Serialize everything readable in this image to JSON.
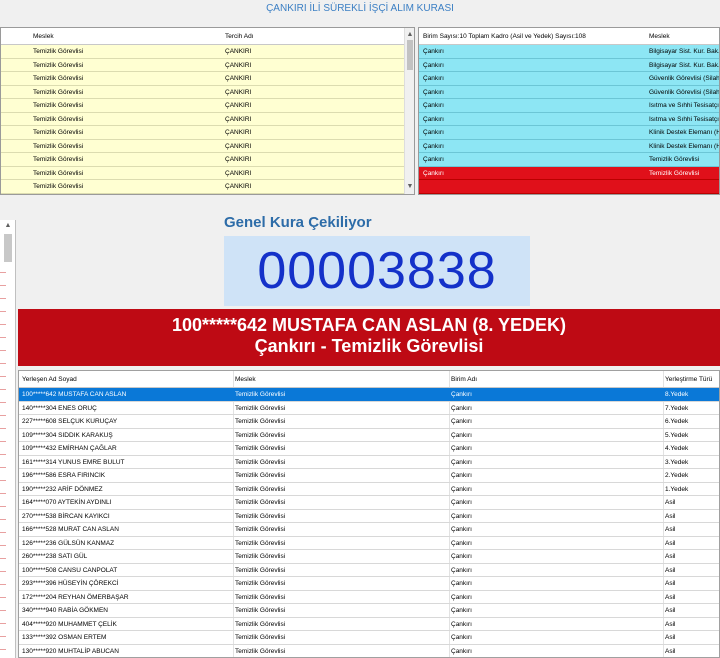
{
  "title": "ÇANKIRI İLİ SÜREKLİ İŞÇİ ALIM KURASI",
  "top_left": {
    "headers": {
      "meslek": "Meslek",
      "tercih": "Tercih Adı"
    },
    "rows": [
      {
        "meslek": "Temizlik Görevlisi",
        "tercih": "ÇANKIRI"
      },
      {
        "meslek": "Temizlik Görevlisi",
        "tercih": "ÇANKIRI"
      },
      {
        "meslek": "Temizlik Görevlisi",
        "tercih": "ÇANKIRI"
      },
      {
        "meslek": "Temizlik Görevlisi",
        "tercih": "ÇANKIRI"
      },
      {
        "meslek": "Temizlik Görevlisi",
        "tercih": "ÇANKIRI"
      },
      {
        "meslek": "Temizlik Görevlisi",
        "tercih": "ÇANKIRI"
      },
      {
        "meslek": "Temizlik Görevlisi",
        "tercih": "ÇANKIRI"
      },
      {
        "meslek": "Temizlik Görevlisi",
        "tercih": "ÇANKIRI"
      },
      {
        "meslek": "Temizlik Görevlisi",
        "tercih": "ÇANKIRI"
      },
      {
        "meslek": "Temizlik Görevlisi",
        "tercih": "ÇANKIRI"
      },
      {
        "meslek": "Temizlik Görevlisi",
        "tercih": "ÇANKIRI"
      }
    ]
  },
  "top_right": {
    "headers": {
      "birim": "Birim Sayısı:10 Toplam Kadro (Asil ve Yedek) Sayısı:108",
      "meslek": "Meslek"
    },
    "rows": [
      {
        "birim": "Çankırı",
        "meslek": "Bilgisayar Sist. Kur. Bak."
      },
      {
        "birim": "Çankırı",
        "meslek": "Bilgisayar Sist. Kur. Bak."
      },
      {
        "birim": "Çankırı",
        "meslek": "Güvenlik Görevlisi (Silahsız)"
      },
      {
        "birim": "Çankırı",
        "meslek": "Güvenlik Görevlisi (Silahsız)"
      },
      {
        "birim": "Çankırı",
        "meslek": "Isıtma ve Sıhhi Tesisatçı"
      },
      {
        "birim": "Çankırı",
        "meslek": "Isıtma ve Sıhhi Tesisatçı"
      },
      {
        "birim": "Çankırı",
        "meslek": "Klinik Destek Elemanı (H)"
      },
      {
        "birim": "Çankırı",
        "meslek": "Klinik Destek Elemanı (H)"
      },
      {
        "birim": "Çankırı",
        "meslek": "Temizlik Görevlisi"
      },
      {
        "birim": "Çankırı",
        "meslek": "Temizlik Görevlisi"
      },
      {
        "birim": "",
        "meslek": ""
      }
    ]
  },
  "kura": {
    "heading": "Genel Kura Çekiliyor",
    "number": "00003838",
    "banner_line1": "100*****642 MUSTAFA CAN ASLAN (8. YEDEK)",
    "banner_line2": "Çankırı - Temizlik Görevlisi"
  },
  "bottom": {
    "headers": {
      "ad": "Yerleşen Ad Soyad",
      "meslek": "Meslek",
      "birim": "Birim Adı",
      "tur": "Yerleştirme Türü"
    },
    "rows": [
      {
        "ad": "100*****642 MUSTAFA CAN ASLAN",
        "meslek": "Temizlik Görevlisi",
        "birim": "Çankırı",
        "tur": "8.Yedek"
      },
      {
        "ad": "140*****304 ENES ORUÇ",
        "meslek": "Temizlik Görevlisi",
        "birim": "Çankırı",
        "tur": "7.Yedek"
      },
      {
        "ad": "227*****608 SELÇUK KURUÇAY",
        "meslek": "Temizlik Görevlisi",
        "birim": "Çankırı",
        "tur": "6.Yedek"
      },
      {
        "ad": "109*****304 SIDDIK KARAKUŞ",
        "meslek": "Temizlik Görevlisi",
        "birim": "Çankırı",
        "tur": "5.Yedek"
      },
      {
        "ad": "109*****432 EMİRHAN ÇAĞLAR",
        "meslek": "Temizlik Görevlisi",
        "birim": "Çankırı",
        "tur": "4.Yedek"
      },
      {
        "ad": "161*****314 YUNUS EMRE BULUT",
        "meslek": "Temizlik Görevlisi",
        "birim": "Çankırı",
        "tur": "3.Yedek"
      },
      {
        "ad": "196*****586 ESRA FIRINCIK",
        "meslek": "Temizlik Görevlisi",
        "birim": "Çankırı",
        "tur": "2.Yedek"
      },
      {
        "ad": "190*****232 ARİF DÖNMEZ",
        "meslek": "Temizlik Görevlisi",
        "birim": "Çankırı",
        "tur": "1.Yedek"
      },
      {
        "ad": "164*****070 AYTEKİN AYDINLI",
        "meslek": "Temizlik Görevlisi",
        "birim": "Çankırı",
        "tur": "Asil"
      },
      {
        "ad": "270*****538 BİRCAN KAYIKCI",
        "meslek": "Temizlik Görevlisi",
        "birim": "Çankırı",
        "tur": "Asil"
      },
      {
        "ad": "166*****528 MURAT CAN ASLAN",
        "meslek": "Temizlik Görevlisi",
        "birim": "Çankırı",
        "tur": "Asil"
      },
      {
        "ad": "126*****236 GÜLSÜN KANMAZ",
        "meslek": "Temizlik Görevlisi",
        "birim": "Çankırı",
        "tur": "Asil"
      },
      {
        "ad": "260*****238 SATI GÜL",
        "meslek": "Temizlik Görevlisi",
        "birim": "Çankırı",
        "tur": "Asil"
      },
      {
        "ad": "100*****508 CANSU CANPOLAT",
        "meslek": "Temizlik Görevlisi",
        "birim": "Çankırı",
        "tur": "Asil"
      },
      {
        "ad": "293*****396 HÜSEYİN ÇÖREKCİ",
        "meslek": "Temizlik Görevlisi",
        "birim": "Çankırı",
        "tur": "Asil"
      },
      {
        "ad": "172*****204 REYHAN ÖMERBAŞAR",
        "meslek": "Temizlik Görevlisi",
        "birim": "Çankırı",
        "tur": "Asil"
      },
      {
        "ad": "340*****940 RABİA GÖKMEN",
        "meslek": "Temizlik Görevlisi",
        "birim": "Çankırı",
        "tur": "Asil"
      },
      {
        "ad": "404*****920 MUHAMMET ÇELİK",
        "meslek": "Temizlik Görevlisi",
        "birim": "Çankırı",
        "tur": "Asil"
      },
      {
        "ad": "133*****392 OSMAN ERTEM",
        "meslek": "Temizlik Görevlisi",
        "birim": "Çankırı",
        "tur": "Asil"
      },
      {
        "ad": "130*****920 MUHTALİP ABUCAN",
        "meslek": "Temizlik Görevlisi",
        "birim": "Çankırı",
        "tur": "Asil"
      }
    ]
  },
  "colors": {
    "accent": "#3b7fc4",
    "top_left_row": "#ffffd2",
    "top_right_row": "#8de6f4",
    "highlight_red": "#e0101a",
    "banner_red": "#be0a14",
    "number_bg": "#cfe3f7",
    "number_text": "#1431c9",
    "selection_blue": "#0a78d7"
  }
}
